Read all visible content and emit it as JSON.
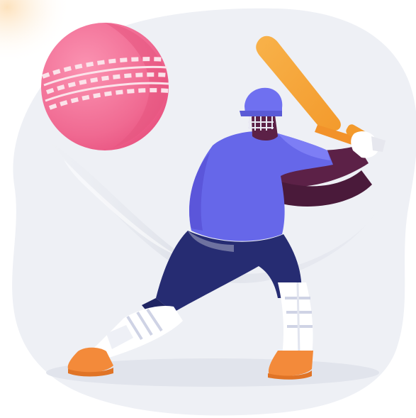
{
  "scene": {
    "subject": "cricket-batsman",
    "colors": {
      "backdrop": "#eef0f5",
      "ball": "#f06a92",
      "ball_highlight": "#f891b0",
      "ball_seam": "#fbe3ea",
      "shirt": "#6667e9",
      "shirt_shadow": "#5b56da",
      "skin": "#5c2147",
      "trousers": "#262c72",
      "pads": "#ffffff",
      "pad_stripes": "#cfd3e5",
      "helmet": "#6f70f0",
      "bat": "#f7a738",
      "shoes": "#f38a3a",
      "glove": "#ffffff",
      "swoosh": "#dfe2ea",
      "corner_glow": "#fde7c7"
    }
  }
}
